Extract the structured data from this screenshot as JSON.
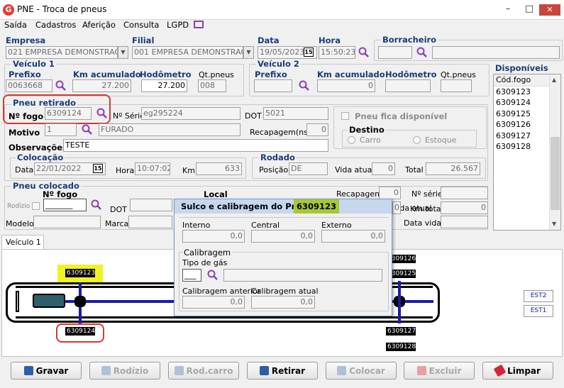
{
  "window": {
    "title": "PNE - Troca de pneus",
    "app_icon": "G",
    "close": "✕"
  },
  "menu": [
    "Saída",
    "Cadastros",
    "Aferição",
    "Consulta",
    "LGPD"
  ],
  "header": {
    "empresa_label": "Empresa",
    "empresa_value": "021 EMPRESA DEMONSTRAC",
    "filial_label": "Filial",
    "filial_value": "001 EMPRESA DEMONSTRAC",
    "data_label": "Data",
    "data_value": "19/05/2023",
    "cal_label": "15",
    "hora_label": "Hora",
    "hora_value": "15:50:23",
    "borracheiro_label": "Borracheiro"
  },
  "veiculo1": {
    "legend": "Veículo 1",
    "prefixo_label": "Prefixo",
    "prefixo_value": "0063668",
    "km_label": "Km acumulado",
    "km_value": "27.200",
    "hod_label": "Hodômetro",
    "hod_value": "27.200",
    "qt_label": "Qt.pneus",
    "qt_value": "008"
  },
  "veiculo2": {
    "legend": "Veículo 2",
    "prefixo_label": "Prefixo",
    "km_label": "Km acumulado",
    "km_value": "0",
    "hod_label": "Hodômetro",
    "qt_label": "Qt.pneus"
  },
  "disponiveis": {
    "title": "Disponíveis",
    "header": "Cód.fogo",
    "items": [
      "6309123",
      "6309124",
      "6309125",
      "6309126",
      "6309127",
      "6309128"
    ]
  },
  "pneu_retirado": {
    "legend": "Pneu retirado",
    "nfogo_label": "Nº fogo",
    "nfogo_value": "6309124",
    "nserie_label": "Nº Série",
    "nserie_value": "eg295224",
    "dot_label": "DOT",
    "dot_value": "5021",
    "fica_disp": "Pneu fica disponível",
    "motivo_label": "Motivo",
    "motivo_code": "1",
    "motivo_desc": "FURADO",
    "recap_label": "Recapagem(ns)",
    "recap_value": "0",
    "destino_legend": "Destino",
    "carro": "Carro",
    "estoque": "Estoque",
    "obs_label": "Observações",
    "obs_value": "TESTE"
  },
  "colocacao": {
    "legend": "Colocação",
    "data_label": "Data",
    "data_value": "22/01/2022",
    "cal_label": "15",
    "hora_label": "Hora",
    "hora_value": "10:07:02",
    "km_label": "Km",
    "km_value": "633"
  },
  "rodado": {
    "legend": "Rodado",
    "posicao_label": "Posição",
    "posicao_value": "DE",
    "vida_label": "Vida atual",
    "vida_value": "0",
    "total_label": "Total",
    "total_value": "26.567"
  },
  "pneu_colocado": {
    "legend": "Pneu colocado",
    "nfogo_label": "Nº fogo",
    "rodizio_label": "Rodízio",
    "dot_label": "DOT",
    "modelo_label": "Modelo",
    "marca_label": "Marca",
    "local_label": "Local",
    "recap_label": "Recapagem",
    "recap_value": "0",
    "nserie_label": "Nº série",
    "kmtotal_label": "Km.total",
    "kmtotal_value": "0",
    "vida_label": "Vida atual",
    "vida_value": "0",
    "datavida_label": "Data vida"
  },
  "tab": {
    "label": "Veículo 1"
  },
  "diagram": {
    "top_left_tire": "6309123",
    "bottom_left_tire": "6309124",
    "right_top_1": "6309126",
    "right_top_2": "6309125",
    "right_bottom_1": "6309127",
    "right_bottom_2": "6309128",
    "est2": "EST2",
    "est1": "EST1"
  },
  "dialog": {
    "title": "Sulco e calibragem do Pneu",
    "tire": "6309123",
    "interno_label": "Interno",
    "interno_value": "0,0",
    "central_label": "Central",
    "central_value": "0,0",
    "externo_label": "Externo",
    "externo_value": "0,0",
    "calibragem_legend": "Calibragem",
    "tipo_gas_label": "Tipo de gás",
    "cal_anterior_label": "Calibragem anterior",
    "cal_anterior_value": "0,0",
    "cal_atual_label": "Calibragem atual",
    "cal_atual_value": "0,0"
  },
  "buttons": {
    "gravar": "Gravar",
    "rodizio": "Rodízio",
    "rodcarro": "Rod.carro",
    "retirar": "Retirar",
    "colocar": "Colocar",
    "excluir": "Excluir",
    "limpar": "Limpar"
  }
}
